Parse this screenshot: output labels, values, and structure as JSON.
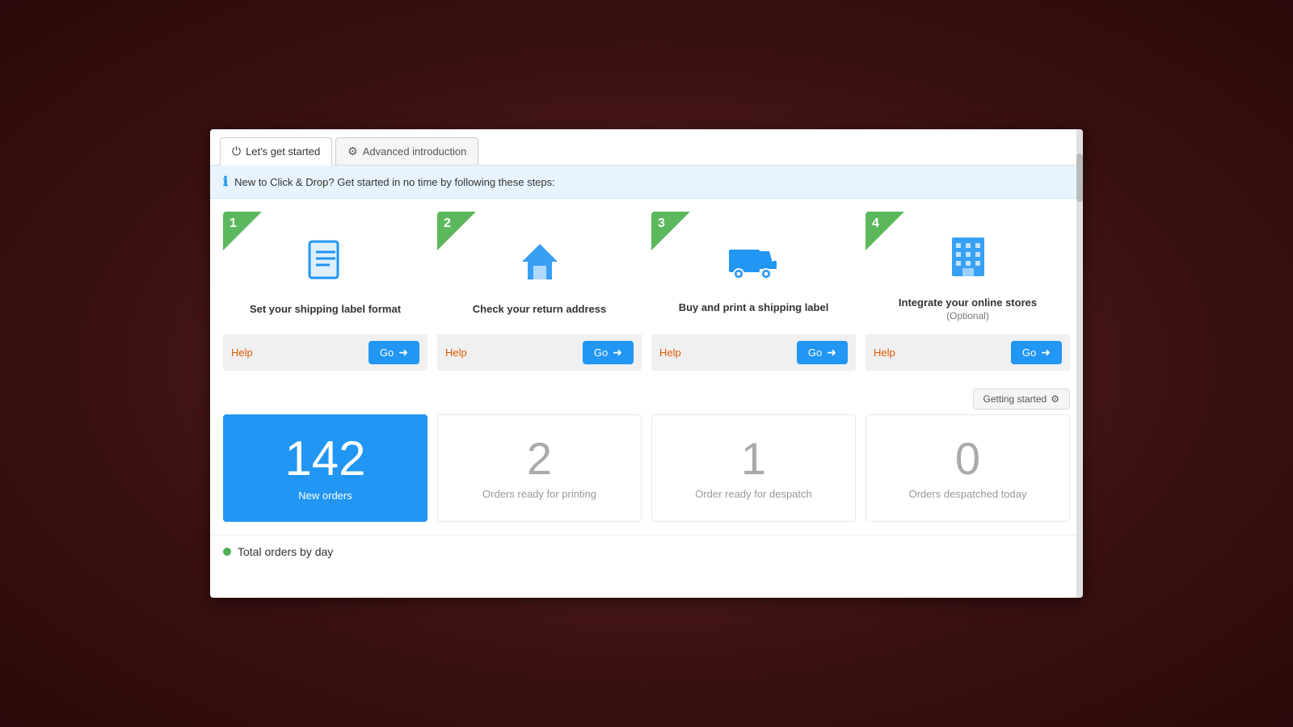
{
  "tabs": [
    {
      "id": "lets-get-started",
      "label": "Let's get started",
      "icon": "⏻",
      "active": true
    },
    {
      "id": "advanced-intro",
      "label": "Advanced introduction",
      "icon": "⚙",
      "active": false
    }
  ],
  "info_bar": {
    "text": "New to Click & Drop? Get started in no time by following these steps:"
  },
  "steps": [
    {
      "number": "1",
      "title": "Set your shipping label format",
      "subtitle": "",
      "help_label": "Help",
      "go_label": "Go"
    },
    {
      "number": "2",
      "title": "Check your return address",
      "subtitle": "",
      "help_label": "Help",
      "go_label": "Go"
    },
    {
      "number": "3",
      "title": "Buy and print a shipping label",
      "subtitle": "",
      "help_label": "Help",
      "go_label": "Go"
    },
    {
      "number": "4",
      "title": "Integrate your online stores",
      "subtitle": "(Optional)",
      "help_label": "Help",
      "go_label": "Go"
    }
  ],
  "getting_started": {
    "label": "Getting started"
  },
  "stats": [
    {
      "number": "142",
      "label": "New orders",
      "highlight": true
    },
    {
      "number": "2",
      "label": "Orders ready for printing",
      "highlight": false
    },
    {
      "number": "1",
      "label": "Order ready for despatch",
      "highlight": false
    },
    {
      "number": "0",
      "label": "Orders despatched today",
      "highlight": false
    }
  ],
  "chart": {
    "legend_dot_color": "#4CAF50",
    "title": "Total orders by day",
    "total_label": "Total"
  }
}
